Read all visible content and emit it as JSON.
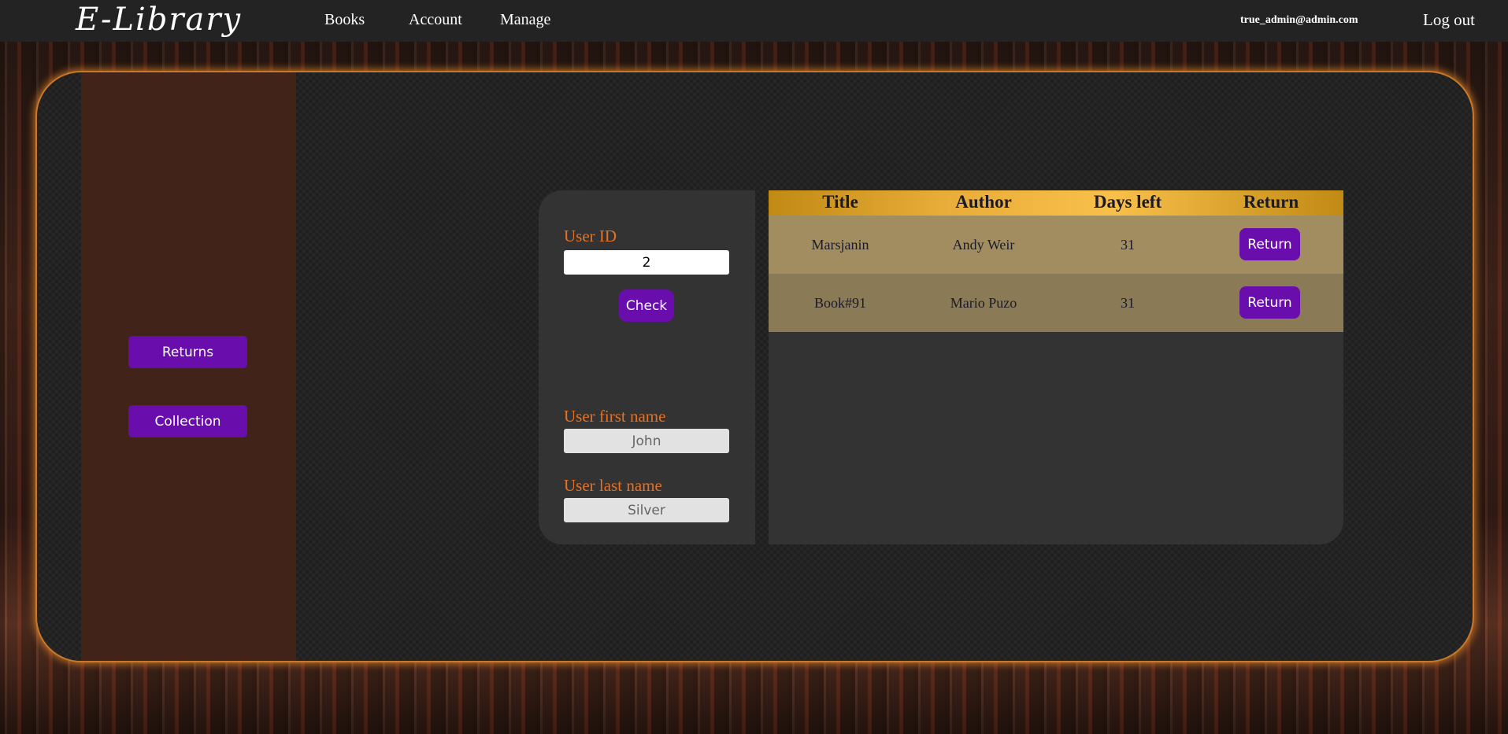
{
  "brand": {
    "logo": "E-Library"
  },
  "nav": {
    "books": "Books",
    "account": "Account",
    "manage": "Manage",
    "user_email": "true_admin@admin.com",
    "logout": "Log out"
  },
  "sidebar": {
    "returns": "Returns",
    "collection": "Collection"
  },
  "user_form": {
    "user_id_label": "User ID",
    "user_id_value": "2",
    "check_label": "Check",
    "first_name_label": "User first name",
    "first_name_value": "John",
    "last_name_label": "User last name",
    "last_name_value": "Silver"
  },
  "loans_table": {
    "headers": [
      "Title",
      "Author",
      "Days left",
      "Return"
    ],
    "rows": [
      {
        "title": "Marsjanin",
        "author": "Andy Weir",
        "days_left": "31",
        "action": "Return"
      },
      {
        "title": "Book#91",
        "author": "Mario Puzo",
        "days_left": "31",
        "action": "Return"
      }
    ]
  },
  "colors": {
    "accent_button": "#6a0dad",
    "label_orange": "#e87020",
    "panel_glow": "#c8782a",
    "sidebar_brown": "#42231a",
    "header_gold": "#f8c04a"
  }
}
